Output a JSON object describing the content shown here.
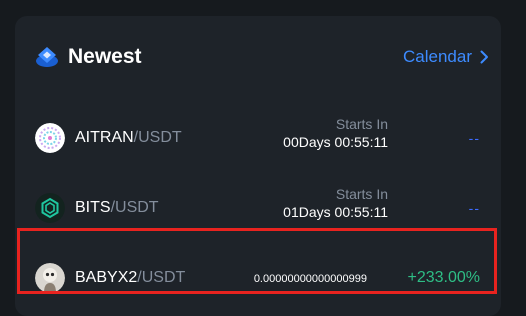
{
  "header": {
    "title": "Newest",
    "calendar_label": "Calendar"
  },
  "colors": {
    "accent_blue": "#3d8bff",
    "positive_green": "#2ebd85",
    "highlight_red": "#e8231f"
  },
  "rows": [
    {
      "base": "AITRAN",
      "quote": "/USDT",
      "starts_label": "Starts In",
      "starts_value": "00Days 00:55:11",
      "change": "--",
      "icon": "aitran-coin-icon"
    },
    {
      "base": "BITS",
      "quote": "/USDT",
      "starts_label": "Starts In",
      "starts_value": "01Days 00:55:11",
      "change": "--",
      "icon": "bits-coin-icon"
    },
    {
      "base": "BABYX2",
      "quote": "/USDT",
      "price": "0.00000000000000999",
      "change": "+233.00%",
      "icon": "babyx2-coin-icon"
    }
  ]
}
